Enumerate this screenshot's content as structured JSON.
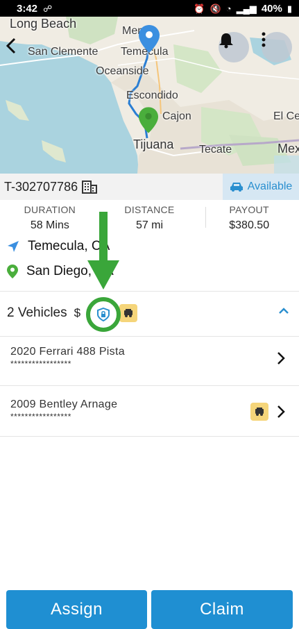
{
  "status_bar": {
    "time": "3:42",
    "battery": "40%"
  },
  "map": {
    "labels": [
      {
        "text": "Long Beach",
        "id": "long-beach"
      },
      {
        "text": "Menife",
        "id": "menifee"
      },
      {
        "text": "San Clemente",
        "id": "san-clemente"
      },
      {
        "text": "Temecula",
        "id": "temecula"
      },
      {
        "text": "Oceanside",
        "id": "oceanside"
      },
      {
        "text": "Escondido",
        "id": "escondido"
      },
      {
        "text": "Cajon",
        "id": "el-cajon"
      },
      {
        "text": "El Ce",
        "id": "el-centro"
      },
      {
        "text": "Tijuana",
        "id": "tijuana"
      },
      {
        "text": "Tecate",
        "id": "tecate"
      },
      {
        "text": "Mex",
        "id": "mexicali"
      }
    ]
  },
  "trip": {
    "id": "T-302707786",
    "status": "Available"
  },
  "stats": {
    "duration_label": "DURATION",
    "duration_value": "58 Mins",
    "distance_label": "DISTANCE",
    "distance_value": "57 mi",
    "payout_label": "PAYOUT",
    "payout_value": "$380.50"
  },
  "route": {
    "origin": "Temecula, CA",
    "destination": "San Diego, CA"
  },
  "vehicles": {
    "header": "2 Vehicles",
    "price": "$",
    "items": [
      {
        "name": "2020 Ferrari 488 Pista",
        "vin": "*****************"
      },
      {
        "name": "2009 Bentley Arnage",
        "vin": "*****************"
      }
    ]
  },
  "actions": {
    "assign": "Assign",
    "claim": "Claim"
  },
  "colors": {
    "primary": "#1f8fd2",
    "annotation": "#3aa63a",
    "tow_badge": "#f5d57a"
  }
}
